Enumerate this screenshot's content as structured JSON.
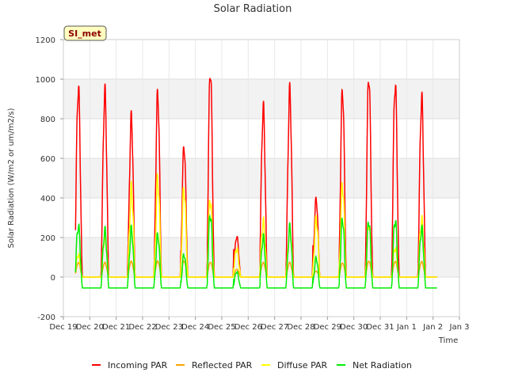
{
  "chart_data": {
    "type": "line",
    "title": "Solar Radiation",
    "xlabel": "Time",
    "ylabel": "Solar Radiation (W/m2 or um/m2/s)",
    "site_label": "SI_met",
    "ylim": [
      -200,
      1200
    ],
    "yticks": [
      -200,
      0,
      200,
      400,
      600,
      800,
      1000,
      1200
    ],
    "xlim": [
      0,
      15
    ],
    "x_tick_labels": [
      "Dec 19",
      "Dec 20",
      "Dec 21",
      "Dec 22",
      "Dec 23",
      "Dec 24",
      "Dec 25",
      "Dec 26",
      "Dec 27",
      "Dec 28",
      "Dec 29",
      "Dec 30",
      "Dec 31",
      "Jan 1",
      "Jan 2",
      "Jan 3"
    ],
    "grid": true,
    "legend_position": "bottom",
    "series": [
      {
        "name": "Incoming PAR",
        "color": "#ff0000",
        "daily_peaks": [
          990,
          985,
          820,
          900,
          630,
          1020,
          210,
          900,
          965,
          385,
          900,
          985,
          995,
          950
        ]
      },
      {
        "name": "Reflected PAR",
        "color": "#ffa500",
        "daily_peaks": [
          75,
          75,
          80,
          80,
          80,
          75,
          40,
          75,
          75,
          30,
          70,
          80,
          80,
          80
        ]
      },
      {
        "name": "Diffuse PAR",
        "color": "#ffff00",
        "daily_peaks": [
          120,
          230,
          460,
          465,
          400,
          370,
          150,
          310,
          260,
          280,
          420,
          250,
          150,
          320
        ]
      },
      {
        "name": "Net Radiation",
        "color": "#00ee00",
        "daily_peaks": [
          275,
          260,
          250,
          200,
          100,
          300,
          30,
          225,
          265,
          90,
          265,
          265,
          295,
          270
        ],
        "night_value": -55
      }
    ]
  }
}
